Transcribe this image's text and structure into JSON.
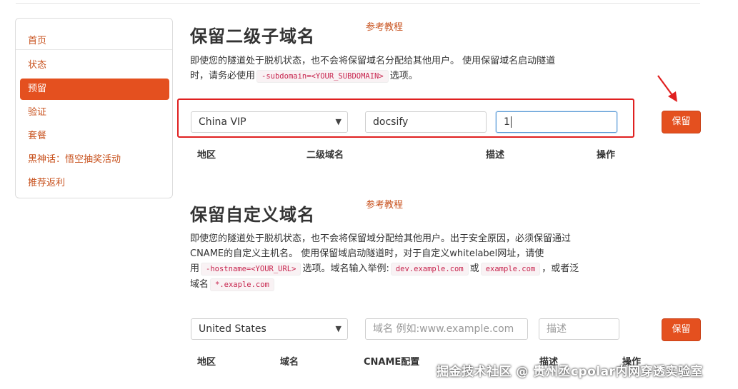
{
  "sidebar": {
    "items": [
      {
        "label": "首页"
      },
      {
        "label": "状态"
      },
      {
        "label": "预留"
      },
      {
        "label": "验证"
      },
      {
        "label": "套餐"
      },
      {
        "label": "黑神话：悟空抽奖活动"
      },
      {
        "label": "推荐返利"
      }
    ],
    "active": "预留"
  },
  "subdomain": {
    "title": "保留二级子域名",
    "tutorial": "参考教程",
    "desc_1": "即使您的隧道处于脱机状态，也不会将保留域名分配给其他用户。 使用保留域名启动隧道",
    "desc_2a": "时，请务必使用",
    "code": "-subdomain=<YOUR_SUBDOMAIN>",
    "desc_2b": "选项。",
    "region_value": "China VIP",
    "subdomain_value": "docsify",
    "description_value": "1",
    "save_label": "保留",
    "columns": [
      "地区",
      "二级域名",
      "描述",
      "操作"
    ]
  },
  "custom": {
    "title": "保留自定义域名",
    "tutorial": "参考教程",
    "line1": "即使您的隧道处于脱机状态，也不会将保留域分配给其他用户。出于安全原因，必须保留通过",
    "line2": "CNAME的自定义主机名。 使用保留域启动隧道时，对于自定义whitelabel网址，请使",
    "line3a": "用",
    "code_hostname": "-hostname=<YOUR_URL>",
    "line3b": "选项。域名输入举例:",
    "code_example1": "dev.example.com",
    "line3c": "或",
    "code_example2": "example.com",
    "line3d": "，或者泛",
    "line4a": "域名",
    "code_wildcard": "*.exaple.com",
    "region_value": "United States",
    "domain_placeholder": "域名 例如:www.example.com",
    "description_placeholder": "描述",
    "save_label": "保留",
    "columns": [
      "地区",
      "域名",
      "CNAME配置",
      "描述",
      "操作"
    ]
  },
  "watermark": "掘金技术社区 @ 贵州丞cpolar内网穿透实验室",
  "colors": {
    "accent": "#e4501f",
    "link": "#c8521e",
    "highlight_box": "#e02020"
  }
}
